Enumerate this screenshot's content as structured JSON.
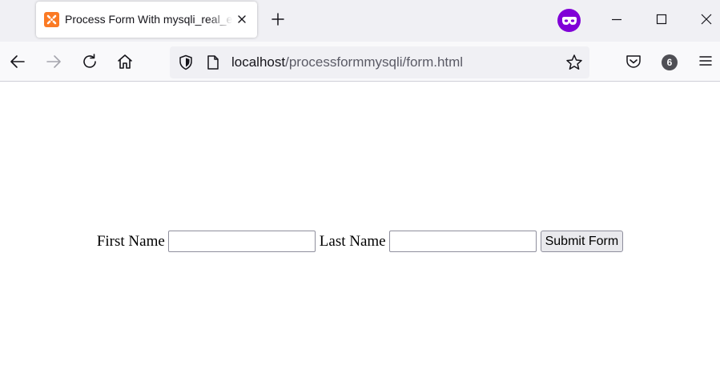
{
  "browser": {
    "tab": {
      "title": "Process Form With mysqli_real_escape_string",
      "favicon": "xampp-icon"
    },
    "new_tab_icon": "plus-icon",
    "private_browsing_icon": "mask-icon",
    "window_controls": [
      "minimize-icon",
      "maximize-icon",
      "close-icon"
    ],
    "toolbar": {
      "back_icon": "arrow-left-icon",
      "forward_icon": "arrow-right-icon",
      "reload_icon": "reload-icon",
      "home_icon": "home-icon",
      "url_host": "localhost",
      "url_path": "/processformmysqli/form.html",
      "bookmark_icon": "star-icon",
      "pocket_icon": "pocket-icon",
      "extension_badge": "6",
      "menu_icon": "hamburger-icon"
    },
    "colors": {
      "tabstrip_bg": "#f0f0f4",
      "toolbar_bg": "#f9f9fb",
      "private_accent": "#8000d7",
      "favicon_accent": "#fb7a24"
    }
  },
  "form": {
    "first_name_label": "First Name",
    "first_name_value": "",
    "last_name_label": "Last Name",
    "last_name_value": "",
    "submit_label": "Submit Form"
  }
}
